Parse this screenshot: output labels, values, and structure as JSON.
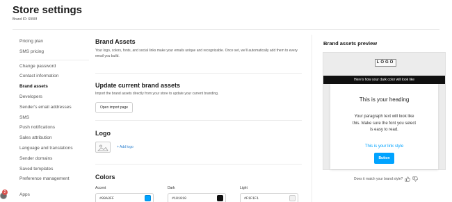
{
  "header": {
    "title": "Store settings",
    "brand_id": "Brand ID: 6990f"
  },
  "sidebar": {
    "group1": [
      "Pricing plan",
      "SMS pricing"
    ],
    "group2": [
      "Change password",
      "Contact information",
      "Brand assets",
      "Developers",
      "Sender's email addresses",
      "SMS",
      "Push notifications",
      "Sales attribution",
      "Language and translations",
      "Sender domains",
      "Saved templates",
      "Preference management"
    ],
    "active": "Brand assets",
    "apps": "Apps",
    "badge_count": "2"
  },
  "main": {
    "brand_assets": {
      "title": "Brand Assets",
      "text": "Your logo, colors, fonts, and social links make your emails unique and recognizable. Once set, we'll automatically add them to every email you build."
    },
    "update": {
      "title": "Update current brand assets",
      "text": "Import the brand assets directly from your store to update your current branding.",
      "button": "Open import page"
    },
    "logo": {
      "title": "Logo",
      "add_label": "+ Add logo"
    },
    "colors": {
      "title": "Colors",
      "fields": [
        {
          "label": "Accent",
          "value": "#00A3FF",
          "swatch": "#00A3FF"
        },
        {
          "label": "Dark",
          "value": "#101010",
          "swatch": "#101010"
        },
        {
          "label": "Light",
          "value": "#F1F1F1",
          "swatch": "#F1F1F1"
        }
      ]
    }
  },
  "preview": {
    "title": "Brand assets preview",
    "logo": "LOGO",
    "dark_text": "Here's how your dark color will look like",
    "heading": "This is your heading",
    "paragraph": "Your paragraph text will look like this. Make sure the font you select is easy to read.",
    "link": "This is your link style",
    "button": "Button",
    "feedback": "Does it match your brand style?"
  },
  "icons": {
    "image_placeholder": "image-icon",
    "thumbs_up": "thumbs-up-icon",
    "thumbs_down": "thumbs-down-icon"
  }
}
